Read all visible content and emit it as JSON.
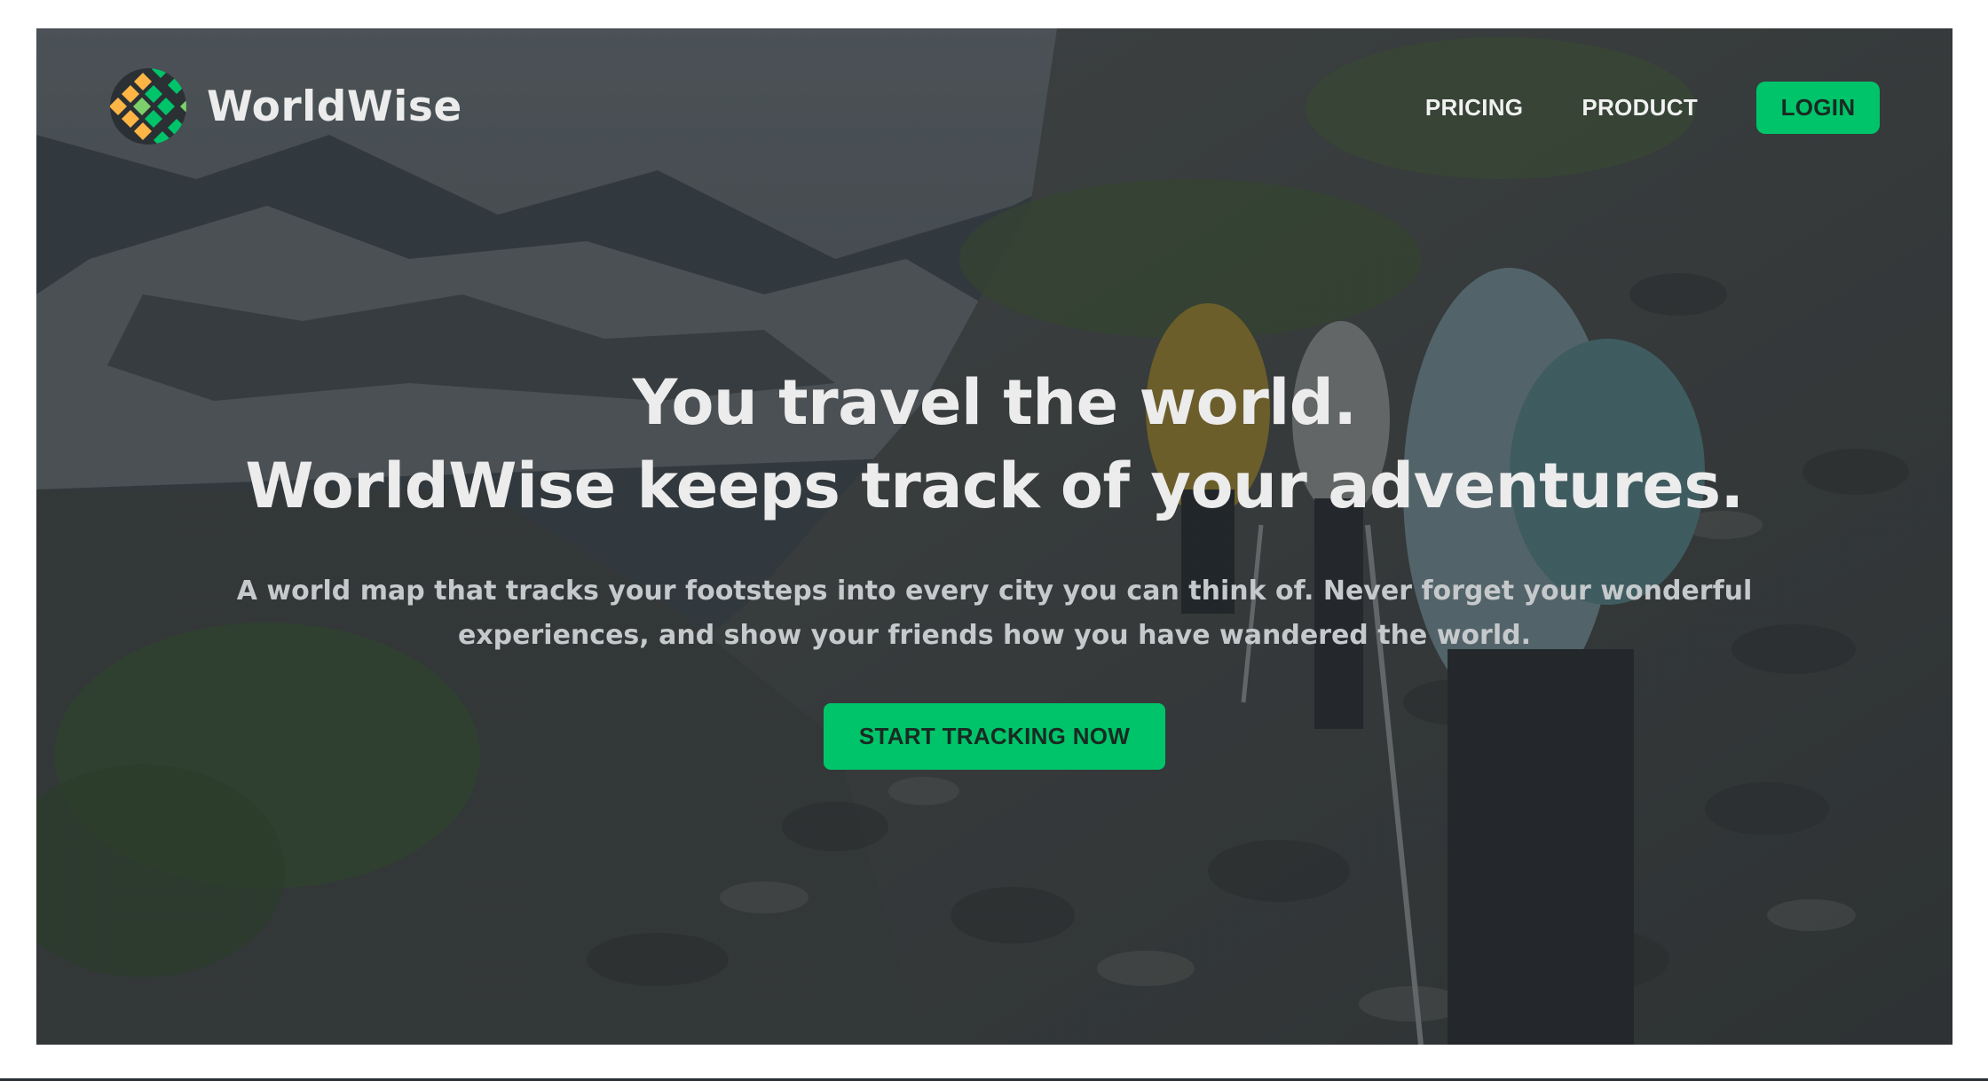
{
  "brand": {
    "name": "WorldWise",
    "logo_icon": "globe-logo-icon"
  },
  "nav": {
    "links": [
      "PRICING",
      "PRODUCT"
    ],
    "login_label": "LOGIN"
  },
  "hero": {
    "title_line1": "You travel the world.",
    "title_line2": "WorldWise keeps track of your adventures.",
    "subtitle": "A world map that tracks your footsteps into every city you can think of. Never forget your wonderful experiences, and show your friends how you have wandered the world.",
    "cta_label": "START TRACKING NOW",
    "background_image": "hikers-on-rocky-mountain-slope"
  },
  "colors": {
    "accent": "#00c46a",
    "logo_yellow": "#ffb545",
    "overlay": "#242a2e",
    "text_light": "#ececec"
  }
}
